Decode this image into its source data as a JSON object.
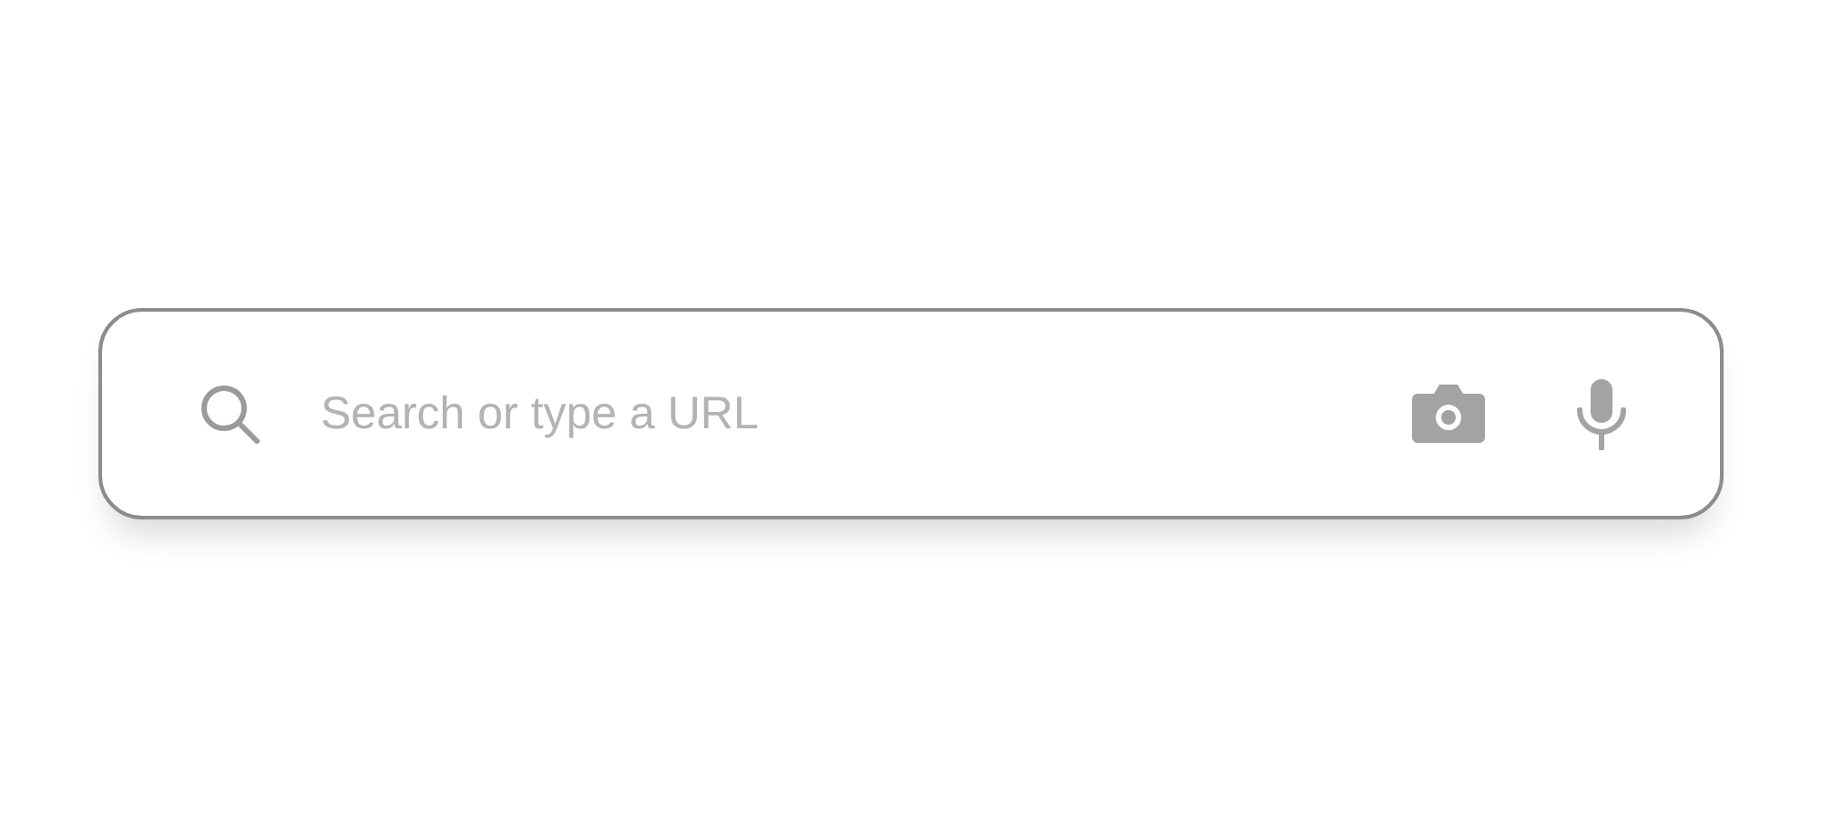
{
  "search": {
    "placeholder": "Search or type a URL"
  }
}
